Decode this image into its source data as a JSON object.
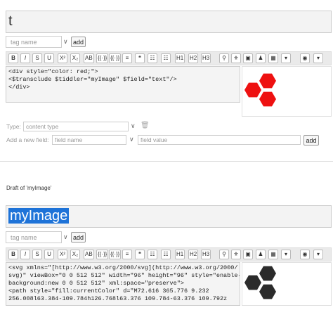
{
  "top_editor": {
    "title": "t",
    "tag_placeholder": "tag name",
    "add_label": "add",
    "toolbar": [
      "B",
      "I",
      "S",
      "U",
      "X²",
      "X₂",
      "AB",
      "{{·}}",
      "{{·}}",
      "≡",
      "❝",
      "☷",
      "☷",
      "H1",
      "H2",
      "H3",
      "⚲",
      "⚜",
      "▣",
      "♟",
      "▦",
      "▾",
      "◉",
      "▾"
    ],
    "code_lines": [
      "<div style=\"color: red;\">",
      "<$transclude $tiddler=\"myImage\" $field=\"text\"/>",
      "</div>"
    ],
    "preview_color": "#ee1111",
    "type_label": "Type:",
    "type_placeholder": "content type",
    "new_field_label": "Add a new field:",
    "field_name_placeholder": "field name",
    "field_value_placeholder": "field value",
    "field_add_label": "add"
  },
  "draft_label": "Draft of 'myImage'",
  "bottom_editor": {
    "title": "myImage",
    "tag_placeholder": "tag name",
    "add_label": "add",
    "toolbar": [
      "B",
      "I",
      "S",
      "U",
      "X²",
      "X₂",
      "AB",
      "{{·}}",
      "{{·}}",
      "≡",
      "❝",
      "☷",
      "☷",
      "H1",
      "H2",
      "H3",
      "⚲",
      "⚜",
      "▣",
      "♟",
      "▦",
      "▾",
      "◉",
      "▾"
    ],
    "code_lines": [
      "<svg xmlns=\"[http://www.w3.org/2000/svg](http://www.w3.org/2000/",
      "svg)\" viewBox=\"0 0 512 512\" width=\"96\" height=\"96\" style=\"enable-",
      "background:new 0 0 512 512\" xml:space=\"preserve\">",
      "<path style=\"fill:currentColor\" d=\"M72.616 365.776 9.232",
      "256.008l63.384-109.784h126.768l63.376 109.784-63.376 109.792z"
    ],
    "preview_color": "#2b2b2b"
  },
  "colors": {
    "selection": "#1e73d8",
    "toolbar_bg": "#eaeaea"
  }
}
